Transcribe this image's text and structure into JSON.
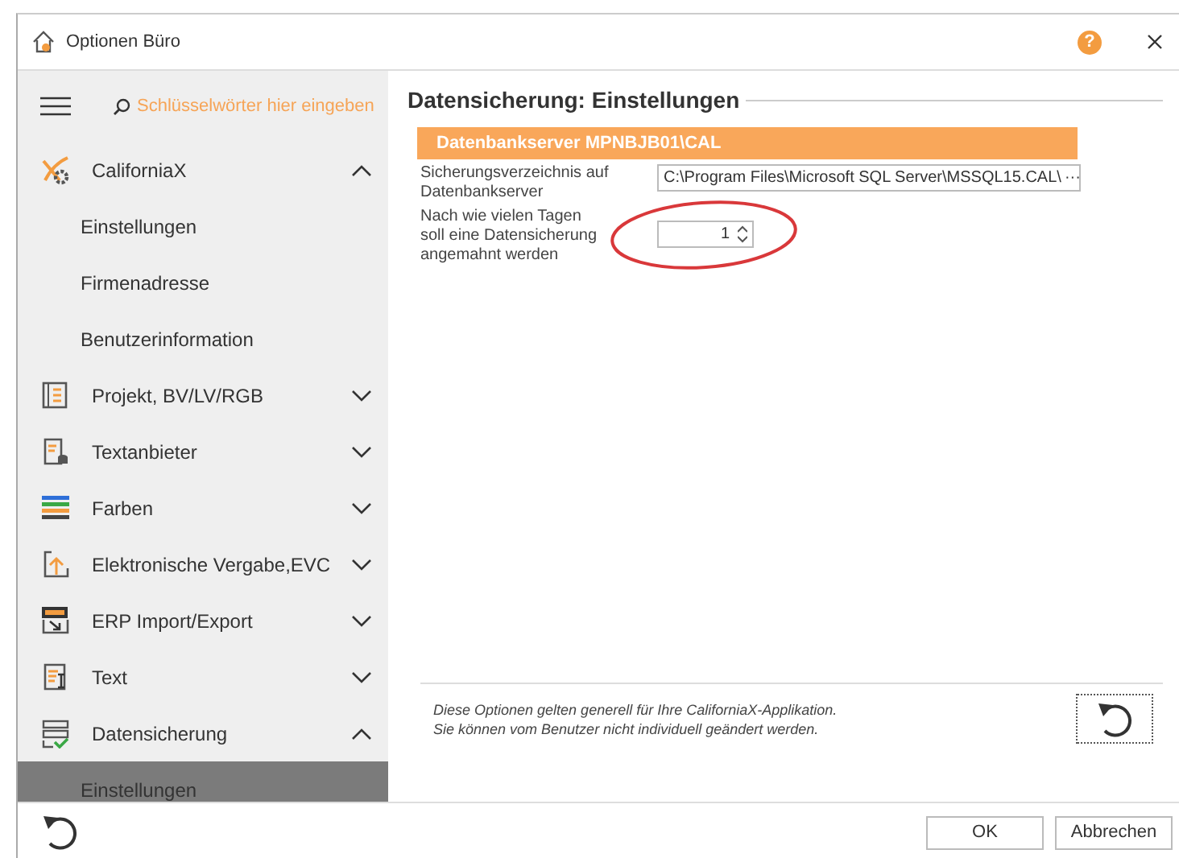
{
  "window": {
    "title": "Optionen Büro",
    "help": "?"
  },
  "sidebar": {
    "search": {
      "placeholder": "Schlüsselwörter hier eingeben"
    },
    "groups": [
      {
        "label": "CaliforniaX",
        "expanded": true,
        "children": [
          {
            "label": "Einstellungen",
            "selected": false
          },
          {
            "label": "Firmenadresse",
            "selected": false
          },
          {
            "label": "Benutzerinformation",
            "selected": false
          }
        ]
      },
      {
        "label": "Projekt, BV/LV/RGB",
        "expanded": false
      },
      {
        "label": "Textanbieter",
        "expanded": false
      },
      {
        "label": "Farben",
        "expanded": false
      },
      {
        "label": "Elektronische Vergabe,EVC",
        "expanded": false
      },
      {
        "label": "ERP Import/Export",
        "expanded": false
      },
      {
        "label": "Text",
        "expanded": false
      },
      {
        "label": "Datensicherung",
        "expanded": true,
        "children": [
          {
            "label": "Einstellungen",
            "selected": true
          }
        ]
      }
    ]
  },
  "content": {
    "heading": "Datensicherung: Einstellungen",
    "section": "Datenbankserver MPNBJB01\\CAL",
    "fields": [
      {
        "kind": "path",
        "label": "Sicherungsverzeichnis auf Datenbankserver",
        "value": "C:\\Program Files\\Microsoft SQL Server\\MSSQL15.CAL\\",
        "button": "···"
      },
      {
        "kind": "spin",
        "label": "Nach wie vielen Tagen soll eine Datensicherung angemahnt werden",
        "value": "1"
      }
    ],
    "note": [
      "Diese Optionen gelten generell für Ihre CaliforniaX-Applikation.",
      "Sie können vom Benutzer nicht individuell geändert werden."
    ]
  },
  "buttons": [
    {
      "label": "OK"
    },
    {
      "label": "Abbrechen"
    }
  ]
}
